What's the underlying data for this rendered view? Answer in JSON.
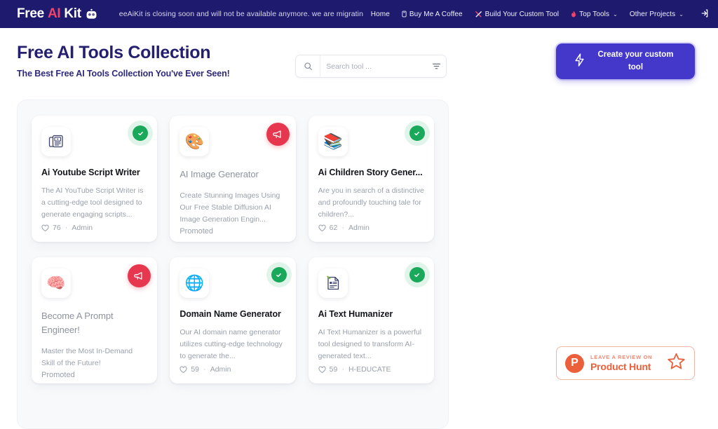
{
  "navbar": {
    "logo": {
      "part1": "Free",
      "part2": "AI",
      "part3": "Kit",
      "icon": "robot-icon"
    },
    "announcement": "eeAiKit is closing soon and will not be available anymore. we are migratin",
    "links": [
      {
        "label": "Home",
        "icon": ""
      },
      {
        "label": "Buy Me A Coffee",
        "icon": "coffee-icon"
      },
      {
        "label": "Build Your Custom Tool",
        "icon": "tools-icon"
      },
      {
        "label": "Top Tools",
        "icon": "fire-icon",
        "caret": "⌄"
      },
      {
        "label": "Other Projects",
        "icon": "",
        "caret": "⌄"
      }
    ],
    "login_icon": "login-icon"
  },
  "header": {
    "title": "Free AI Tools Collection",
    "subtitle": "The Best Free AI Tools Collection You've Ever Seen!"
  },
  "search": {
    "placeholder": "Search tool ...",
    "value": "",
    "search_icon": "search-icon",
    "filter_icon": "filter-icon"
  },
  "cta": {
    "label": "Create your custom tool",
    "icon": "lightning-icon",
    "color": "#4338ca"
  },
  "cards": [
    {
      "title": "Ai Youtube Script Writer",
      "description": "The AI YouTube Script Writer is a cutting-edge tool designed to generate engaging scripts...",
      "icon": "video-script-icon",
      "icon_glyph": "📰",
      "badge": "verified",
      "likes": "76",
      "author": "Admin",
      "promoted": false
    },
    {
      "title": "AI Image Generator",
      "description": "Create Stunning Images Using Our Free Stable Diffusion AI Image Generation Engin...",
      "icon": "palette-icon",
      "icon_glyph": "🎨",
      "badge": "promo",
      "promo_label": "Promoted",
      "promoted": true
    },
    {
      "title": "Ai Children Story Gener...",
      "description": "Are you in search of a distinctive and profoundly touching tale for children?...",
      "icon": "story-book-icon",
      "icon_glyph": "📚",
      "badge": "verified",
      "likes": "62",
      "author": "Admin",
      "promoted": false
    },
    {
      "title": "Become A Prompt Engineer!",
      "description": "Master the Most In-Demand Skill of the Future!",
      "icon": "brain-bulb-icon",
      "icon_glyph": "🧠",
      "badge": "promo",
      "promo_label": "Promoted",
      "promoted": true
    },
    {
      "title": "Domain Name Generator",
      "description": "Our AI domain name generator utilizes cutting-edge technology to generate the...",
      "icon": "globe-icon",
      "icon_glyph": "🌐",
      "badge": "verified",
      "likes": "59",
      "author": "Admin",
      "promoted": false
    },
    {
      "title": "Ai Text Humanizer",
      "description": "AI Text Humanizer is a powerful tool designed to transform AI-generated text...",
      "icon": "document-edit-icon",
      "icon_glyph": "📝",
      "badge": "verified",
      "likes": "59",
      "author": "H-EDUCATE",
      "promoted": false
    }
  ],
  "product_hunt": {
    "letter": "P",
    "top_line": "LEAVE A REVIEW ON",
    "main_line": "Product Hunt",
    "star_icon": "star-icon",
    "color": "#ec5f3b"
  }
}
